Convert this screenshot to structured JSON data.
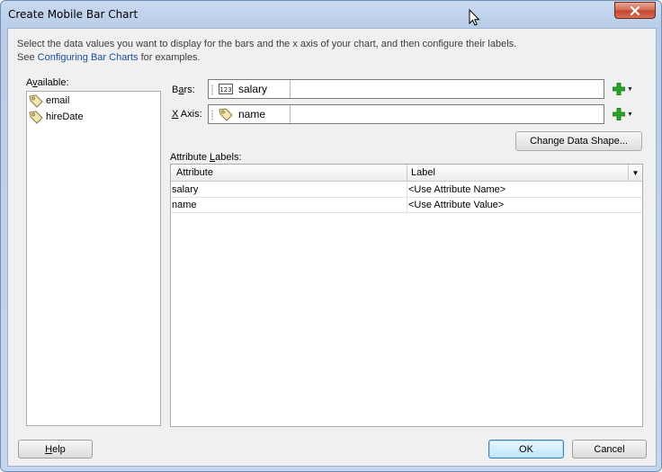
{
  "window": {
    "title": "Create Mobile Bar Chart"
  },
  "description": {
    "line1": "Select the data values you want to display for the bars and the x axis of your chart, and then configure their labels.",
    "line2_prefix": "See ",
    "line2_link": "Configuring Bar Charts",
    "line2_suffix": " for examples."
  },
  "available": {
    "label_first": "A",
    "label_underlined": "v",
    "label_rest": "ailable:",
    "items": [
      {
        "label": "email",
        "icon": "tag-icon"
      },
      {
        "label": "hireDate",
        "icon": "tag-icon"
      }
    ]
  },
  "bars": {
    "label_first": "B",
    "label_underlined": "a",
    "label_rest": "rs:",
    "value": "salary",
    "icon": "numeric-123-icon"
  },
  "xaxis": {
    "label_underlined": "X",
    "label_rest": " Axis:",
    "value": "name",
    "icon": "tag-icon"
  },
  "change_shape_label": "Change Data Shape...",
  "attribute_labels": {
    "label_prefix": "Attribute ",
    "label_underlined": "L",
    "label_rest": "abels:",
    "columns": [
      "Attribute",
      "Label"
    ],
    "rows": [
      {
        "attribute": "salary",
        "label": "<Use Attribute Name>"
      },
      {
        "attribute": "name",
        "label": "<Use Attribute Value>"
      }
    ]
  },
  "buttons": {
    "help_underlined": "H",
    "help_rest": "elp",
    "ok": "OK",
    "cancel": "Cancel"
  },
  "colors": {
    "link": "#1a4fa0",
    "accent_add": "#2aa52a",
    "close": "#c4432c"
  }
}
